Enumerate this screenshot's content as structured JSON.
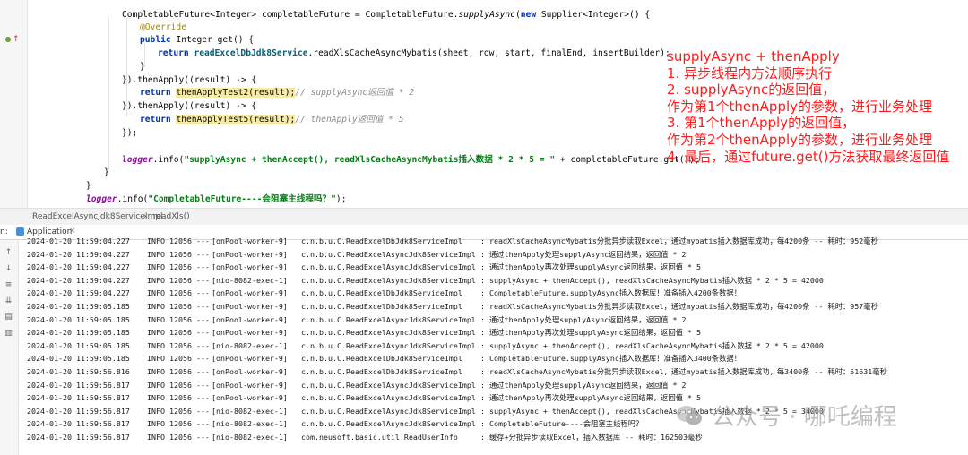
{
  "code": {
    "l1": {
      "a": "CompletableFuture<Integer> completableFuture = CompletableFuture.",
      "b": "supplyAsync",
      "c": "(",
      "d": "new",
      "e": " Supplier<Integer>() {"
    },
    "l2": "@Override",
    "l3": {
      "a": "public",
      "b": " Integer get() {"
    },
    "l4": {
      "a": "return",
      "b": " ",
      "c": "readExcelDbJdk8Service",
      "d": ".readXlsCacheAsyncMybatis(sheet, row, start, finalEnd, insertBuilder);"
    },
    "l5": "}",
    "l6": "}).thenApply((result) -> {",
    "l7": {
      "a": "return",
      "b": " ",
      "c": "thenApplyTest2(result);",
      "d": "// supplyAsync返回值 * 2"
    },
    "l8": "}).thenApply((result) -> {",
    "l9": {
      "a": "return",
      "b": " ",
      "c": "thenApplyTest5(result);",
      "d": "// thenApply返回值 * 5"
    },
    "l10": "});",
    "l11": {
      "a": "logger",
      "b": ".info(",
      "c": "\"supplyAsync + thenAccept(), readXlsCacheAsyncMybatis插入数据 * 2 * 5 = \"",
      "d": " + completableFuture.get());"
    },
    "l12": "}",
    "l13": "}",
    "l14": {
      "a": "logger",
      "b": ".info(",
      "c": "\"CompletableFuture----会阻塞主线程吗？\"",
      "d": ");"
    }
  },
  "annotation": {
    "lines": [
      "supplyAsync + thenApply",
      "1. 异步线程内方法顺序执行",
      "2. supplyAsync的返回值，",
      "作为第1个thenApply的参数，进行业务处理",
      "3. 第1个thenApply的返回值，",
      "作为第2个thenApply的参数，进行业务处理",
      "4. 最后，通过future.get()方法获取最终返回值"
    ]
  },
  "breadcrumb": {
    "class": "ReadExcelAsyncJdk8ServiceImpl",
    "sep": "›",
    "method": "readXls()"
  },
  "run": {
    "label": "n:",
    "tab": "Application",
    "close": "×"
  },
  "console": {
    "rows": [
      {
        "ts": "2024-01-20 11:59:04.227",
        "lv": "INFO 12056 ---",
        "th": "[onPool-worker-9]",
        "cl": "c.n.b.u.C.ReadExcelDbJdk8ServiceImpl",
        "ms": ": readXlsCacheAsyncMybatis分批异步读取Excel，通过mybatis插入数据库成功，每4200条 -- 耗时：952毫秒"
      },
      {
        "ts": "2024-01-20 11:59:04.227",
        "lv": "INFO 12056 ---",
        "th": "[onPool-worker-9]",
        "cl": "c.n.b.u.C.ReadExcelAsyncJdk8ServiceImpl",
        "ms": ": 通过thenApply处理supplyAsync返回结果，返回值 * 2"
      },
      {
        "ts": "2024-01-20 11:59:04.227",
        "lv": "INFO 12056 ---",
        "th": "[onPool-worker-9]",
        "cl": "c.n.b.u.C.ReadExcelAsyncJdk8ServiceImpl",
        "ms": ": 通过thenApply再次处理supplyAsync返回结果，返回值 * 5"
      },
      {
        "ts": "2024-01-20 11:59:04.227",
        "lv": "INFO 12056 ---",
        "th": "[nio-8082-exec-1]",
        "cl": "c.n.b.u.C.ReadExcelAsyncJdk8ServiceImpl",
        "ms": ": supplyAsync + thenAccept(), readXlsCacheAsyncMybatis插入数据 * 2 * 5 = 42000"
      },
      {
        "ts": "2024-01-20 11:59:04.227",
        "lv": "INFO 12056 ---",
        "th": "[onPool-worker-9]",
        "cl": "c.n.b.u.C.ReadExcelDbJdk8ServiceImpl",
        "ms": ": CompletableFuture.supplyAsync插入数据库！准备插入4200条数据！"
      },
      {
        "ts": "2024-01-20 11:59:05.185",
        "lv": "INFO 12056 ---",
        "th": "[onPool-worker-9]",
        "cl": "c.n.b.u.C.ReadExcelDbJdk8ServiceImpl",
        "ms": ": readXlsCacheAsyncMybatis分批异步读取Excel，通过mybatis插入数据库成功，每4200条 -- 耗时：957毫秒"
      },
      {
        "ts": "2024-01-20 11:59:05.185",
        "lv": "INFO 12056 ---",
        "th": "[onPool-worker-9]",
        "cl": "c.n.b.u.C.ReadExcelAsyncJdk8ServiceImpl",
        "ms": ": 通过thenApply处理supplyAsync返回结果，返回值 * 2"
      },
      {
        "ts": "2024-01-20 11:59:05.185",
        "lv": "INFO 12056 ---",
        "th": "[onPool-worker-9]",
        "cl": "c.n.b.u.C.ReadExcelAsyncJdk8ServiceImpl",
        "ms": ": 通过thenApply再次处理supplyAsync返回结果，返回值 * 5"
      },
      {
        "ts": "2024-01-20 11:59:05.185",
        "lv": "INFO 12056 ---",
        "th": "[nio-8082-exec-1]",
        "cl": "c.n.b.u.C.ReadExcelAsyncJdk8ServiceImpl",
        "ms": ": supplyAsync + thenAccept(), readXlsCacheAsyncMybatis插入数据 * 2 * 5 = 42000"
      },
      {
        "ts": "2024-01-20 11:59:05.185",
        "lv": "INFO 12056 ---",
        "th": "[onPool-worker-9]",
        "cl": "c.n.b.u.C.ReadExcelDbJdk8ServiceImpl",
        "ms": ": CompletableFuture.supplyAsync插入数据库！准备插入3400条数据！"
      },
      {
        "ts": "2024-01-20 11:59:56.816",
        "lv": "INFO 12056 ---",
        "th": "[onPool-worker-9]",
        "cl": "c.n.b.u.C.ReadExcelDbJdk8ServiceImpl",
        "ms": ": readXlsCacheAsyncMybatis分批异步读取Excel，通过mybatis插入数据库成功，每3400条 -- 耗时：51631毫秒"
      },
      {
        "ts": "2024-01-20 11:59:56.817",
        "lv": "INFO 12056 ---",
        "th": "[onPool-worker-9]",
        "cl": "c.n.b.u.C.ReadExcelAsyncJdk8ServiceImpl",
        "ms": ": 通过thenApply处理supplyAsync返回结果，返回值 * 2"
      },
      {
        "ts": "2024-01-20 11:59:56.817",
        "lv": "INFO 12056 ---",
        "th": "[onPool-worker-9]",
        "cl": "c.n.b.u.C.ReadExcelAsyncJdk8ServiceImpl",
        "ms": ": 通过thenApply再次处理supplyAsync返回结果，返回值 * 5"
      },
      {
        "ts": "2024-01-20 11:59:56.817",
        "lv": "INFO 12056 ---",
        "th": "[nio-8082-exec-1]",
        "cl": "c.n.b.u.C.ReadExcelAsyncJdk8ServiceImpl",
        "ms": ": supplyAsync + thenAccept(), readXlsCacheAsyncMybatis插入数据 * 2 * 5 = 34000"
      },
      {
        "ts": "2024-01-20 11:59:56.817",
        "lv": "INFO 12056 ---",
        "th": "[nio-8082-exec-1]",
        "cl": "c.n.b.u.C.ReadExcelAsyncJdk8ServiceImpl",
        "ms": ": CompletableFuture----会阻塞主线程吗？"
      },
      {
        "ts": "2024-01-20 11:59:56.817",
        "lv": "INFO 12056 ---",
        "th": "[nio-8082-exec-1]",
        "cl": "com.neusoft.basic.util.ReadUserInfo",
        "ms": ": 缓存+分批异步读取Excel，插入数据库 -- 耗时：162503毫秒"
      }
    ]
  },
  "watermark": {
    "text": "公众号 · 哪吒编程"
  },
  "colors": {
    "annotation": "#ff1b1b",
    "keyword": "#0033b3",
    "string": "#067d17",
    "highlight": "#f5eaa6"
  }
}
